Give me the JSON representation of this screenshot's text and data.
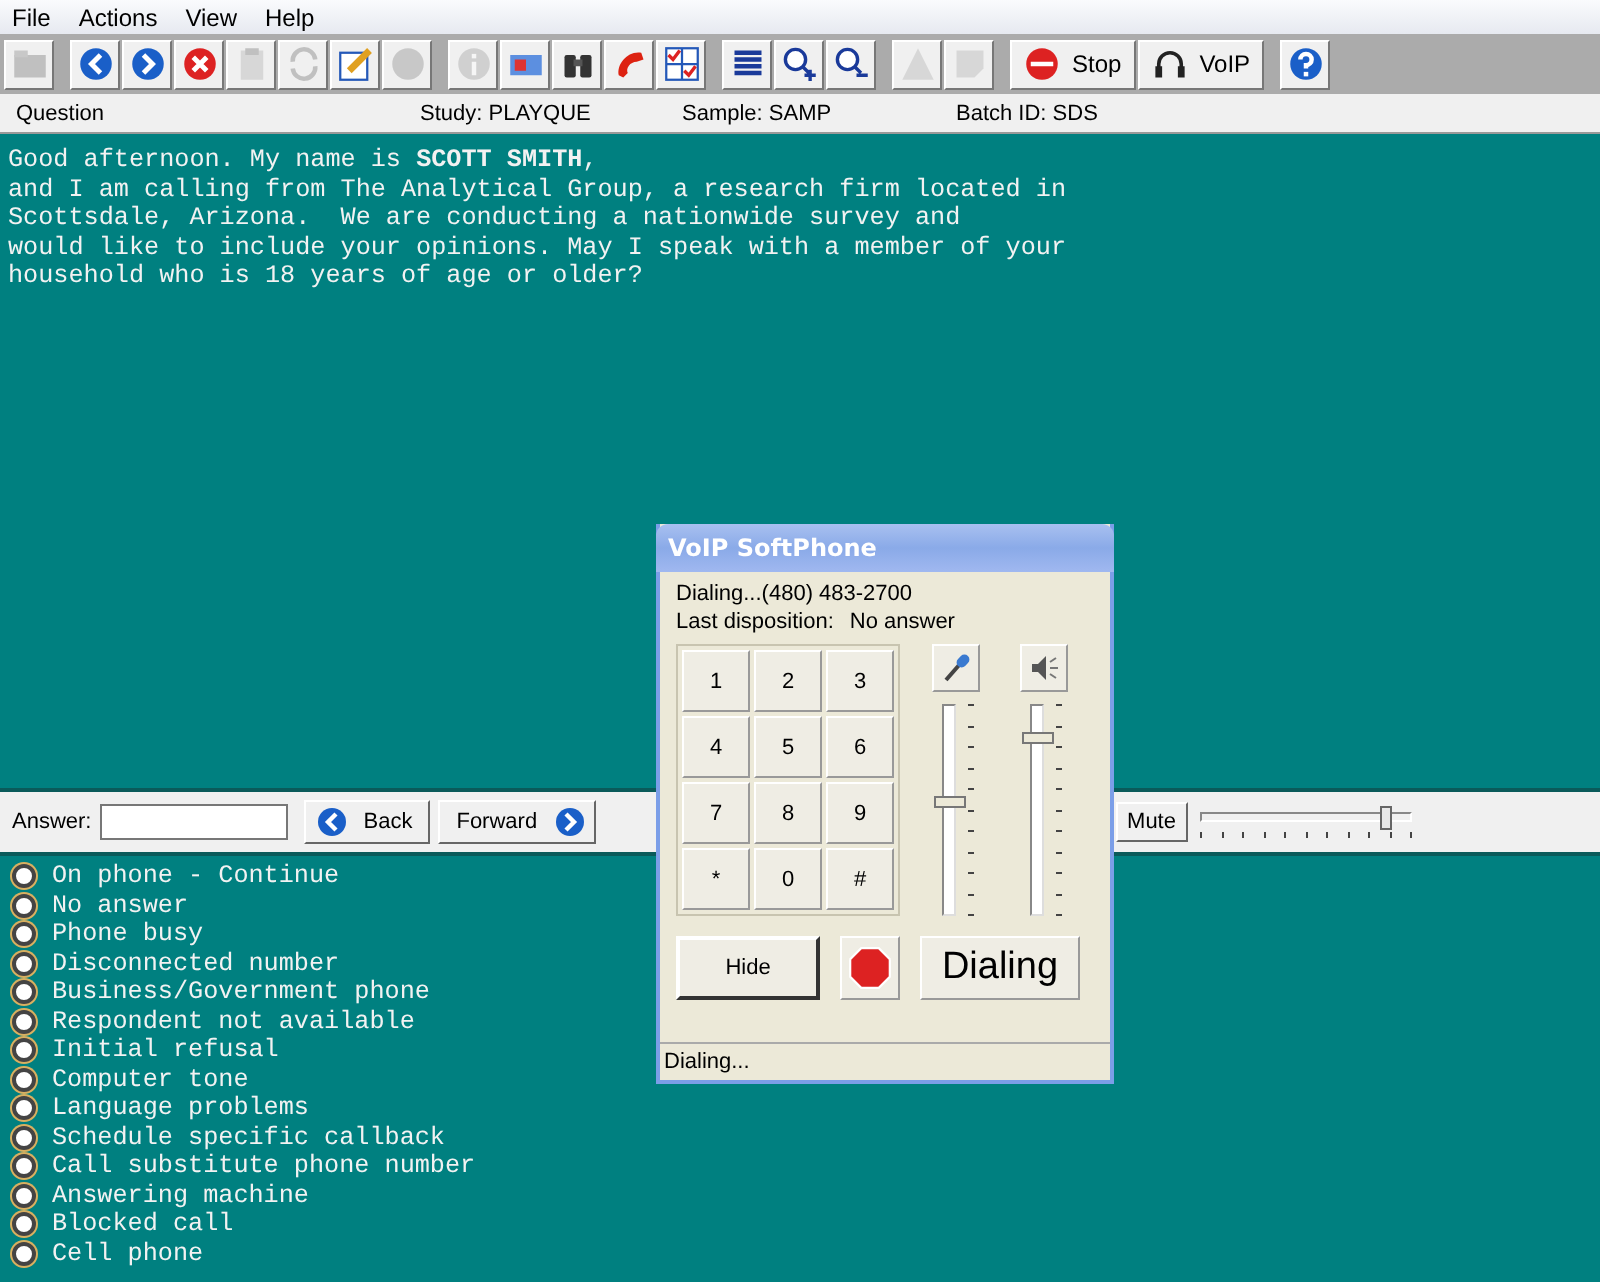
{
  "menu": [
    "File",
    "Actions",
    "View",
    "Help"
  ],
  "toolbar_groups": [
    [
      {
        "disabled": true
      }
    ],
    [
      {
        "disabled": false
      },
      {
        "disabled": false
      },
      {
        "disabled": false
      },
      {
        "disabled": true
      },
      {
        "disabled": true
      },
      {
        "disabled": false
      },
      {
        "disabled": true
      }
    ],
    [
      {
        "disabled": true
      },
      {
        "disabled": false
      },
      {
        "disabled": false
      },
      {
        "disabled": false
      },
      {
        "disabled": false
      }
    ],
    [
      {
        "disabled": false
      },
      {
        "disabled": false
      },
      {
        "disabled": false
      }
    ],
    [
      {
        "disabled": true
      },
      {
        "disabled": true
      }
    ],
    [
      {
        "label": "Stop",
        "disabled": false
      },
      {
        "label": "VoIP",
        "disabled": false
      }
    ],
    [
      {
        "disabled": false
      }
    ]
  ],
  "header": {
    "question": "Question",
    "study": "Study: PLAYQUE",
    "sample": "Sample: SAMP",
    "batch": "Batch ID: SDS"
  },
  "question_text": "Good afternoon. My name is **SCOTT SMITH**,\nand I am calling from The Analytical Group, a research firm located in\nScottsdale, Arizona.  We are conducting a nationwide survey and\nwould like to include your opinions. May I speak with a member of your\nhousehold who is 18 years of age or older?",
  "answer": {
    "label": "Answer:",
    "back": "Back",
    "forward": "Forward"
  },
  "mute": {
    "label": "Mute",
    "level": 0.87
  },
  "options": [
    {
      "label": "On phone - Continue",
      "selected": false
    },
    {
      "label": "No answer",
      "selected": false
    },
    {
      "label": "Phone busy",
      "selected": false
    },
    {
      "label": "Disconnected number",
      "selected": false
    },
    {
      "label": "Business/Government phone",
      "selected": false
    },
    {
      "label": "Respondent not available",
      "selected": false
    },
    {
      "label": "Initial refusal",
      "selected": false
    },
    {
      "label": "Computer tone",
      "selected": false
    },
    {
      "label": "Language problems",
      "selected": false
    },
    {
      "label": "Schedule specific callback",
      "selected": false
    },
    {
      "label": "Call substitute phone number",
      "selected": false
    },
    {
      "label": "Answering machine",
      "selected": false
    },
    {
      "label": "Blocked call",
      "selected": false
    },
    {
      "label": "Cell phone",
      "selected": false
    }
  ],
  "softphone": {
    "title": "VoIP SoftPhone",
    "dialing": "Dialing...(480) 483-2700",
    "last_disposition_label": "Last disposition:",
    "last_disposition": "No answer",
    "keys": [
      "1",
      "2",
      "3",
      "4",
      "5",
      "6",
      "7",
      "8",
      "9",
      "*",
      "0",
      "#"
    ],
    "mic": {
      "level": 0.55
    },
    "speaker": {
      "level": 0.85
    },
    "hide": "Hide",
    "call_button": "Dialing",
    "status": "Dialing..."
  }
}
